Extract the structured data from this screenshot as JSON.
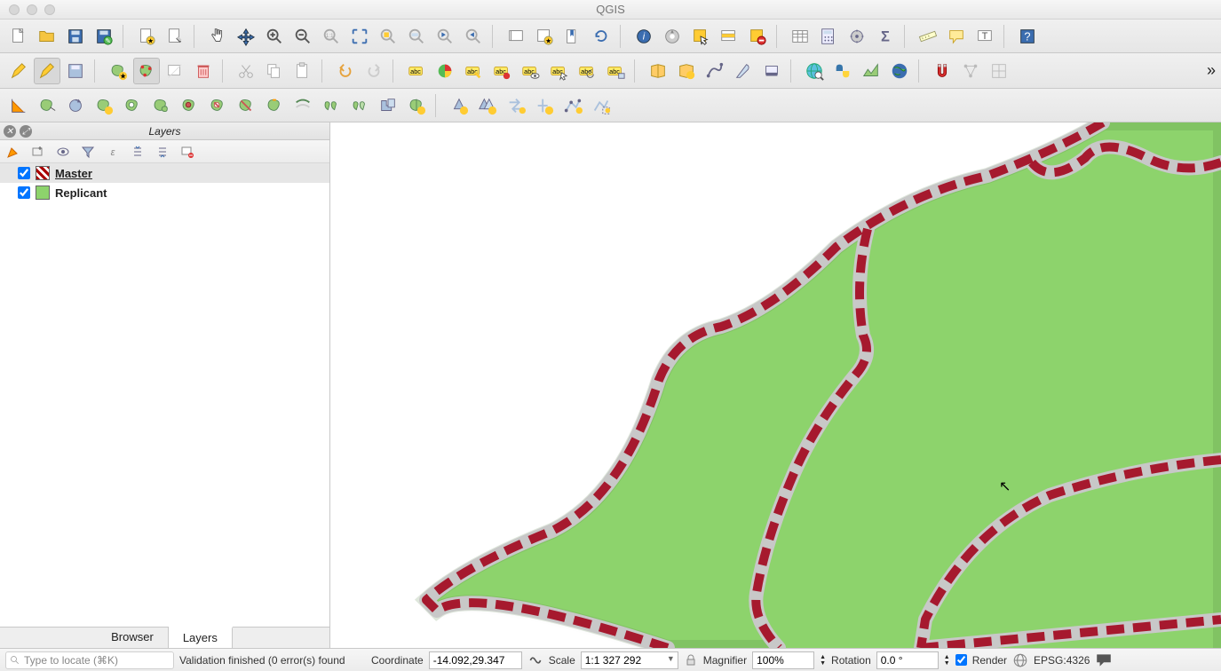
{
  "window": {
    "title": "QGIS"
  },
  "layers_panel": {
    "title": "Layers",
    "layers": [
      {
        "name": "Master",
        "checked": true
      },
      {
        "name": "Replicant",
        "checked": true
      }
    ]
  },
  "bottom_tabs": {
    "browser": "Browser",
    "layers": "Layers"
  },
  "status": {
    "locator_placeholder": "Type to locate (⌘K)",
    "validation_msg": "Validation finished (0 error(s) found",
    "coordinate_label": "Coordinate",
    "coordinate_value": "-14.092,29.347",
    "scale_label": "Scale",
    "scale_value": "1:1 327 292",
    "magnifier_label": "Magnifier",
    "magnifier_value": "100%",
    "rotation_label": "Rotation",
    "rotation_value": "0.0 °",
    "render_label": "Render",
    "crs_value": "EPSG:4326"
  },
  "colors": {
    "polygon_fill": "#8dd36c",
    "boundary_dash": "#a6192e",
    "boundary_line": "#c0c0c0"
  }
}
